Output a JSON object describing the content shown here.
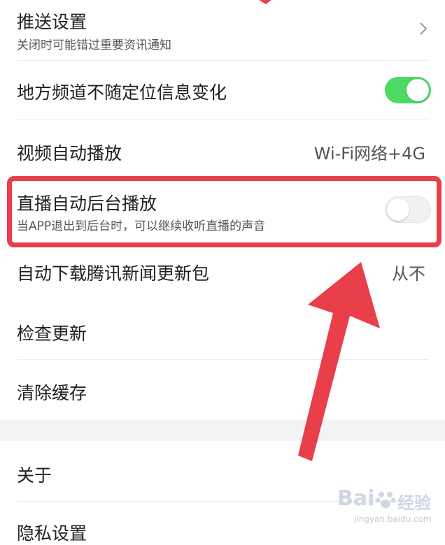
{
  "settings": {
    "push": {
      "title": "推送设置",
      "subtitle": "关闭时可能错过重要资讯通知"
    },
    "local_channel": {
      "title": "地方频道不随定位信息变化",
      "enabled": true
    },
    "video_autoplay": {
      "title": "视频自动播放",
      "value": "Wi-Fi网络+4G"
    },
    "live_background": {
      "title": "直播自动后台播放",
      "subtitle": "当APP退出到后台时，可以继续收听直播的声音",
      "enabled": false
    },
    "auto_download": {
      "title": "自动下载腾讯新闻更新包",
      "value": "从不"
    },
    "check_update": {
      "title": "检查更新"
    },
    "clear_cache": {
      "title": "清除缓存"
    },
    "about": {
      "title": "关于"
    },
    "privacy": {
      "title": "隐私设置"
    }
  },
  "annotation": {
    "highlight_color": "#e83f4a"
  },
  "colors": {
    "toggle_on": "#4cd964",
    "toggle_off": "#f1f1f1"
  },
  "watermark": {
    "brand": "Bai",
    "brand2": "经验",
    "url": "jingyan.baidu.com"
  }
}
